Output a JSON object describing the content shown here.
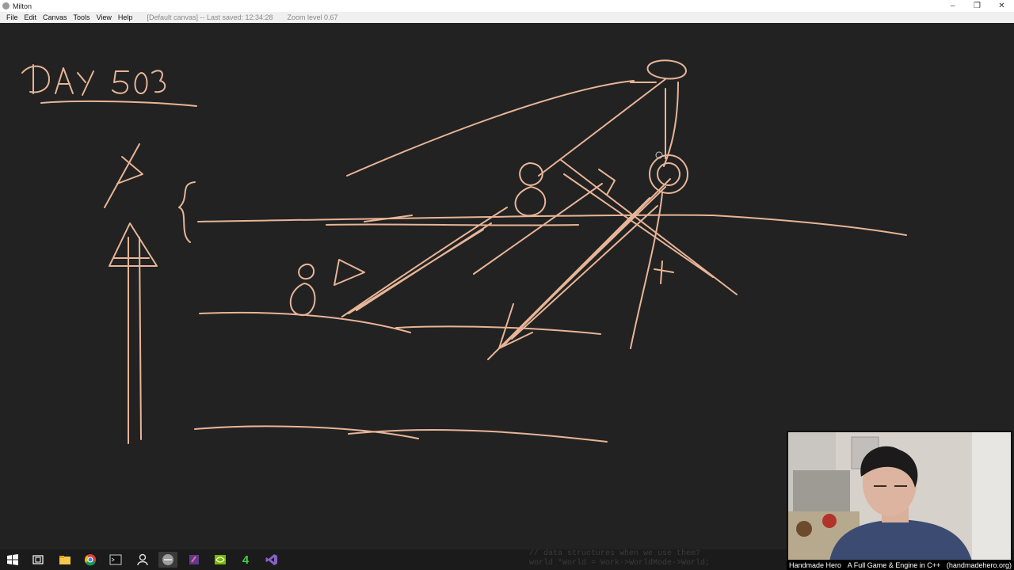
{
  "window": {
    "title": "Milton",
    "minimize_glyph": "–",
    "restore_glyph": "❐",
    "close_glyph": "✕"
  },
  "menu": {
    "items": [
      "File",
      "Edit",
      "Canvas",
      "Tools",
      "View",
      "Help"
    ],
    "status": "[Default canvas] -- Last saved: 12:34:28",
    "zoom": "Zoom level 0.67"
  },
  "canvas": {
    "heading": "DAY 503",
    "stroke_color": "#e7b597",
    "background": "#222222"
  },
  "taskbar": {
    "icons": [
      "windows-start-icon",
      "task-view-icon",
      "file-explorer-icon",
      "chrome-icon",
      "terminal-icon",
      "user-icon",
      "milton-icon",
      "paint-icon",
      "nvidia-icon",
      "4coder-icon",
      "visual-studio-icon"
    ],
    "app4_label": "4",
    "bg_code_line1": "// data structures when we use them?",
    "bg_code_line2": "world *World = Work->WorldMode->World;"
  },
  "caption": {
    "left": "Handmade Hero",
    "middle": "A Full Game & Engine in C++",
    "right": "(handmadehero.org)"
  }
}
